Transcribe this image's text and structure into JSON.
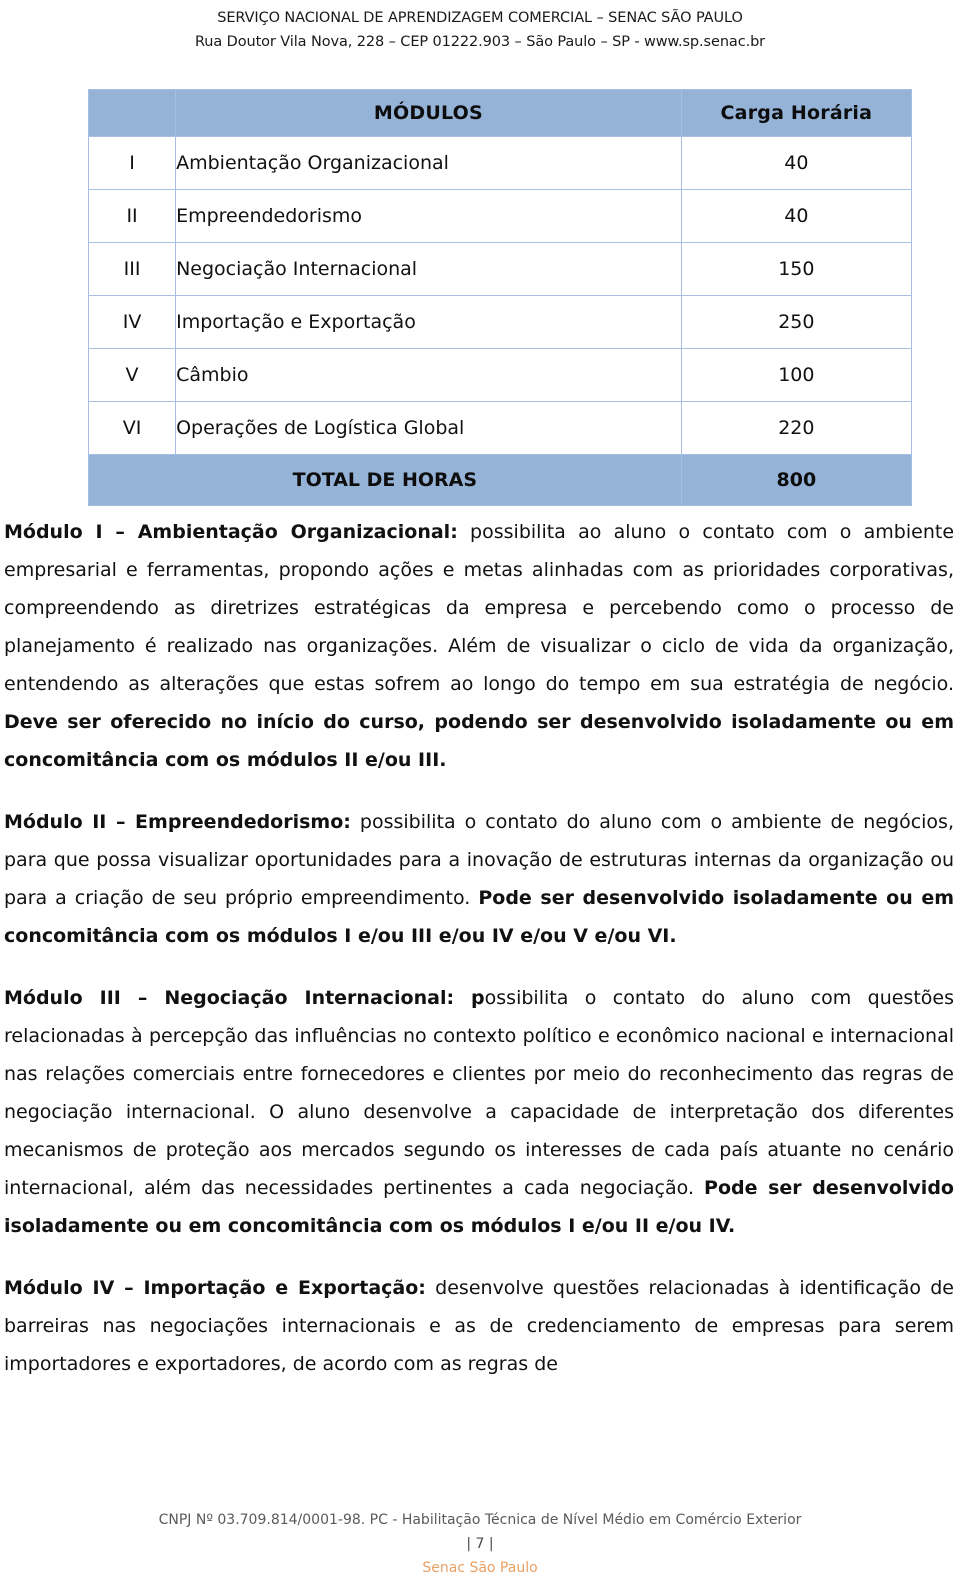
{
  "header": {
    "line1": "SERVIÇO NACIONAL DE APRENDIZAGEM COMERCIAL – SENAC SÃO PAULO",
    "line2": "Rua Doutor Vila Nova, 228 – CEP 01222.903 – São Paulo – SP - www.sp.senac.br"
  },
  "table": {
    "columns": {
      "roman": "",
      "modules": "MÓDULOS",
      "workload": "Carga Horária"
    },
    "rows": [
      {
        "roman": "I",
        "name": "Ambientação Organizacional",
        "hours": "40"
      },
      {
        "roman": "II",
        "name": "Empreendedorismo",
        "hours": "40"
      },
      {
        "roman": "III",
        "name": "Negociação Internacional",
        "hours": "150"
      },
      {
        "roman": "IV",
        "name": "Importação e Exportação",
        "hours": "250"
      },
      {
        "roman": "V",
        "name": "Câmbio",
        "hours": "100"
      },
      {
        "roman": "VI",
        "name": "Operações de Logística Global",
        "hours": "220"
      }
    ],
    "total": {
      "label": "TOTAL DE HORAS",
      "value": "800"
    },
    "header_bg": "#95b3d7",
    "border_color": "#a7bfe0"
  },
  "content": {
    "modulo1": {
      "title": "Módulo I – Ambientação Organizacional:",
      "text1": " possibilita ao aluno o contato com o ambiente empresarial e ferramentas, propondo ações e metas alinhadas com as prioridades corporativas, compreendendo as diretrizes estratégicas da empresa e percebendo como o processo de planejamento é realizado nas organizações. Além de visualizar o ciclo de vida da organização, entendendo as alterações que estas sofrem ao longo do tempo em sua estratégia de negócio. ",
      "bold_tail": "Deve ser oferecido no início do curso, podendo ser desenvolvido isoladamente ou em concomitância com os módulos II e/ou III."
    },
    "modulo2": {
      "title": "Módulo II – Empreendedorismo:",
      "text1": " possibilita o contato do aluno com o ambiente de negócios, para que possa visualizar oportunidades para a inovação de estruturas internas da organização ou para a criação de seu próprio empreendimento. ",
      "bold_tail": "Pode ser desenvolvido isoladamente ou em concomitância com os módulos I e/ou III e/ou IV e/ou V e/ou VI."
    },
    "modulo3": {
      "title": "Módulo III – Negociação Internacional: p",
      "text1": "ossibilita o contato do aluno com questões relacionadas à percepção das influências no contexto político e econômico nacional e internacional nas relações comerciais entre fornecedores e clientes por meio do reconhecimento das regras de negociação internacional. O aluno desenvolve a capacidade de interpretação dos diferentes mecanismos de proteção aos mercados segundo os interesses de cada país atuante no cenário internacional, além das necessidades pertinentes a cada negociação. ",
      "bold_tail": "Pode ser desenvolvido isoladamente ou em concomitância com os módulos I e/ou II e/ou IV."
    },
    "modulo4": {
      "title": "Módulo IV – Importação e Exportação:",
      "text1": " desenvolve questões relacionadas à identificação de barreiras nas negociações internacionais e as de credenciamento de empresas para serem importadores e exportadores, de acordo com as regras de"
    }
  },
  "footer": {
    "cnpj_line": "CNPJ Nº 03.709.814/0001-98. PC - Habilitação Técnica de Nível Médio em Comércio Exterior",
    "page_number": "| 7 |",
    "brand": "Senac São Paulo",
    "brand_color": "#e8a165"
  }
}
